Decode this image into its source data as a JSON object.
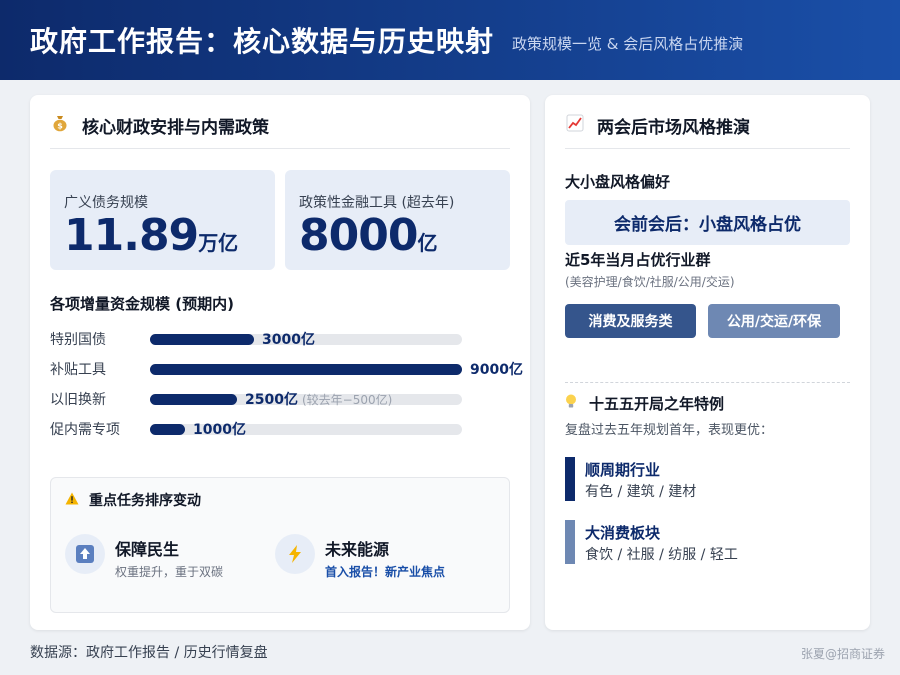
{
  "header": {
    "title": "政府工作报告：核心数据与历史映射",
    "subtitle": "政策规模一览 & 会后风格占优推演"
  },
  "left_card": {
    "title": "核心财政安排与内需政策",
    "title_icon": "money-bag-icon",
    "stats": [
      {
        "label": "广义债务规模",
        "value": "11.89",
        "unit": "万亿"
      },
      {
        "label": "政策性金融工具 (超去年)",
        "value": "8000",
        "unit": "亿"
      }
    ],
    "section_title": "各项增量资金规模 (预期内)",
    "bars": [
      {
        "name": "特别国债",
        "amount": 3000,
        "label": "3000亿",
        "note": ""
      },
      {
        "name": "补贴工具",
        "amount": 9000,
        "label": "9000亿",
        "note": ""
      },
      {
        "name": "以旧换新",
        "amount": 2500,
        "label": "2500亿",
        "note": "(较去年−500亿)"
      },
      {
        "name": "促内需专项",
        "amount": 1000,
        "label": "1000亿",
        "note": ""
      }
    ],
    "bar_max": 9000,
    "tasks": {
      "title": "重点任务排序变动",
      "items": [
        {
          "title": "保障民生",
          "desc": "权重提升，重于双碳"
        },
        {
          "title": "未来能源",
          "desc": "首入报告！新产业焦点"
        }
      ]
    }
  },
  "right_card": {
    "title": "两会后市场风格推演",
    "title_icon": "chart-up-icon",
    "size_pref_title": "大小盘风格偏好",
    "banner": "会前会后：小盘风格占优",
    "industry_title": "近5年当月占优行业群",
    "industry_list": "(美容护理/食饮/社服/公用/交运)",
    "buttons": [
      "消费及服务类",
      "公用/交运/环保"
    ],
    "special_title": "十五五开局之年特例",
    "special_desc": "复盘过去五年规划首年，表现更优：",
    "items": [
      {
        "title": "顺周期行业",
        "desc": "有色 / 建筑 / 建材",
        "color": "#0d2a6b"
      },
      {
        "title": "大消费板块",
        "desc": "食饮 / 社服 / 纺服 / 轻工",
        "color": "#6e88b3"
      }
    ]
  },
  "footer": {
    "source": "数据源：政府工作报告 / 历史行情复盘",
    "author": "张夏@招商证券"
  }
}
